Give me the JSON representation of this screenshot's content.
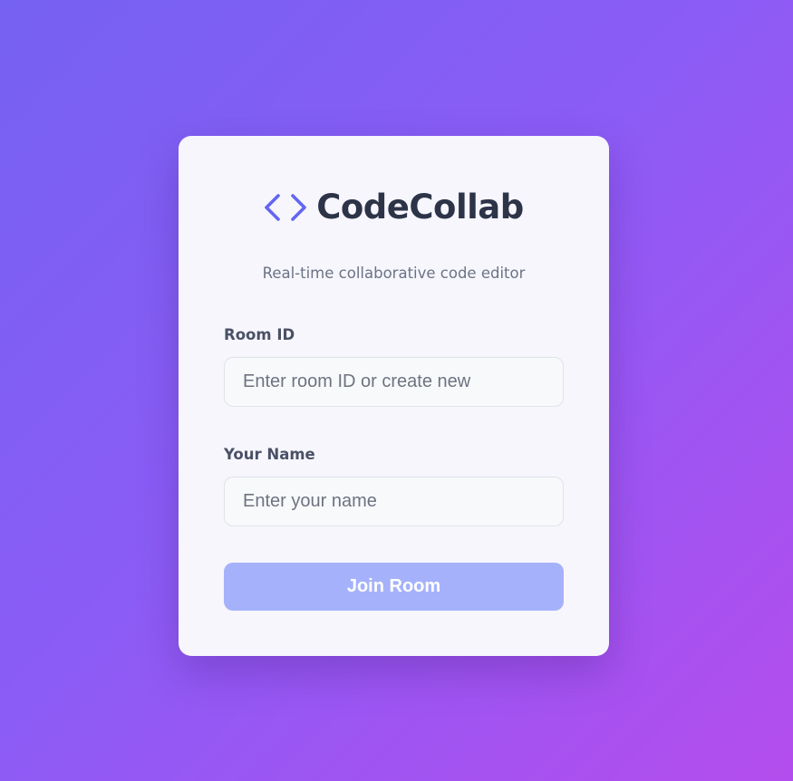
{
  "brand": {
    "icon": "code-brackets-icon",
    "title": "CodeCollab",
    "subtitle": "Real-time collaborative code editor"
  },
  "form": {
    "room_id": {
      "label": "Room ID",
      "value": "",
      "placeholder": "Enter room ID or create new"
    },
    "name": {
      "label": "Your Name",
      "value": "",
      "placeholder": "Enter your name"
    },
    "submit_label": "Join Room"
  },
  "colors": {
    "background_gradient_start": "#7561f2",
    "background_gradient_end": "#b44ded",
    "accent": "#6366f1",
    "button_disabled": "#a5b2fb",
    "title_text": "#2d3448"
  }
}
